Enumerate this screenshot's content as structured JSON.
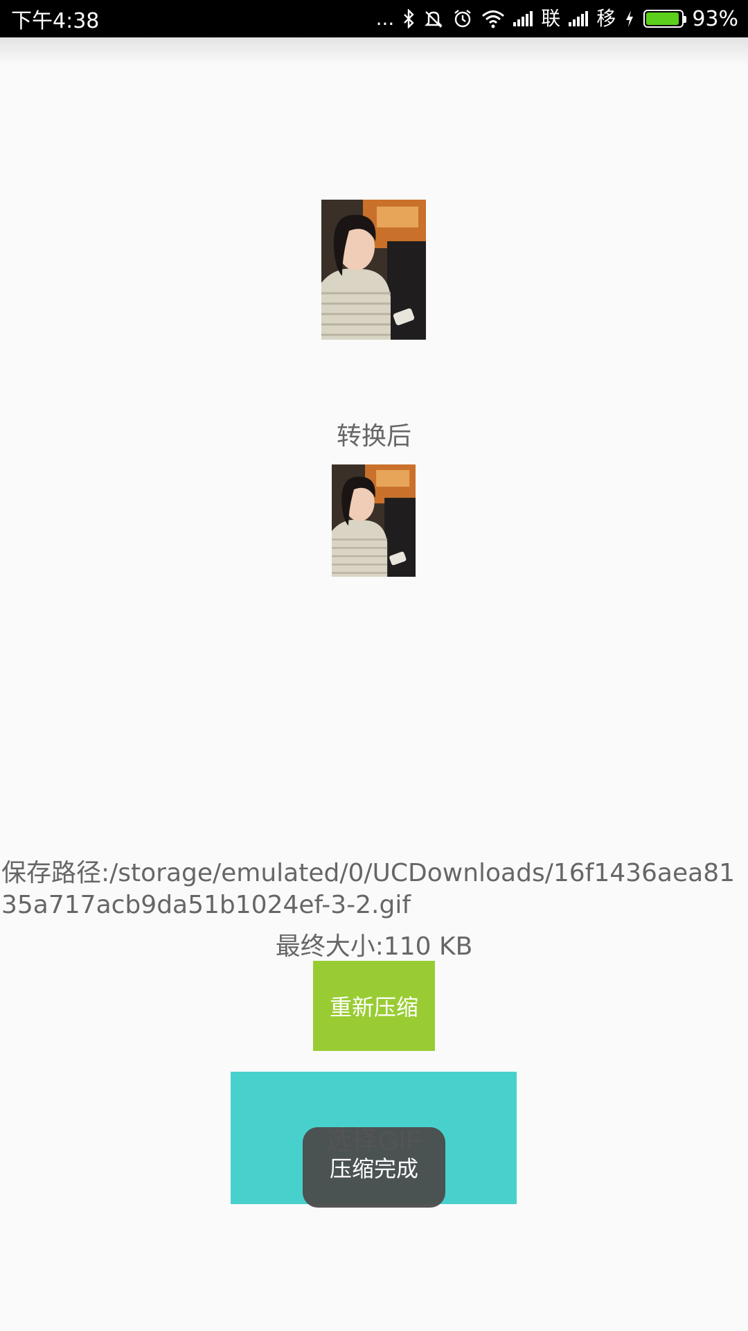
{
  "status_bar": {
    "time": "下午4:38",
    "dots": "...",
    "carrier1": "联",
    "carrier2": "移",
    "battery_percent": "93%",
    "battery_level": 0.93,
    "battery_color": "#5ccf1c"
  },
  "main": {
    "after_label": "转换后",
    "save_path": "保存路径:/storage/emulated/0/UCDownloads/16f1436aea8135a717acb9da51b1024ef-3-2.gif",
    "final_size": "最终大小:110 KB",
    "recompress_button": "重新压缩",
    "select_gif_button": "选择GIF",
    "toast": "压缩完成"
  },
  "colors": {
    "recompress_bg": "#99cc33",
    "select_bg": "#48d1cc",
    "background": "#fafafa"
  }
}
